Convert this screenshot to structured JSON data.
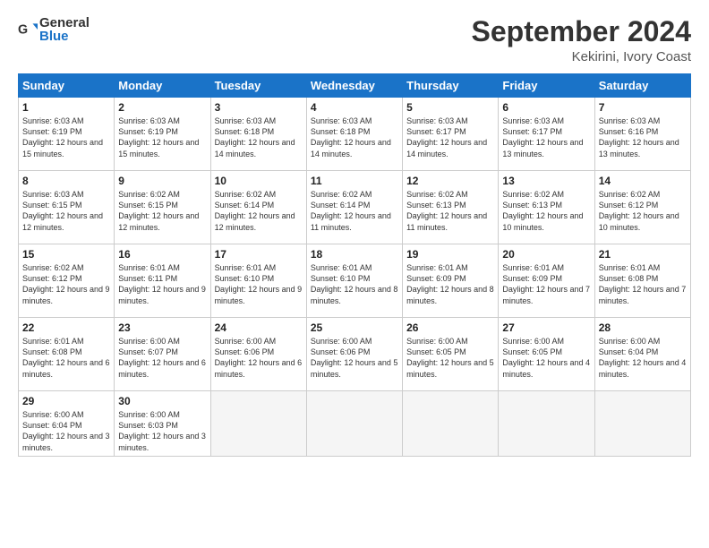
{
  "header": {
    "logo_general": "General",
    "logo_blue": "Blue",
    "month_title": "September 2024",
    "location": "Kekirini, Ivory Coast"
  },
  "weekdays": [
    "Sunday",
    "Monday",
    "Tuesday",
    "Wednesday",
    "Thursday",
    "Friday",
    "Saturday"
  ],
  "weeks": [
    [
      {
        "day": "1",
        "sunrise": "6:03 AM",
        "sunset": "6:19 PM",
        "daylight": "12 hours and 15 minutes."
      },
      {
        "day": "2",
        "sunrise": "6:03 AM",
        "sunset": "6:19 PM",
        "daylight": "12 hours and 15 minutes."
      },
      {
        "day": "3",
        "sunrise": "6:03 AM",
        "sunset": "6:18 PM",
        "daylight": "12 hours and 14 minutes."
      },
      {
        "day": "4",
        "sunrise": "6:03 AM",
        "sunset": "6:18 PM",
        "daylight": "12 hours and 14 minutes."
      },
      {
        "day": "5",
        "sunrise": "6:03 AM",
        "sunset": "6:17 PM",
        "daylight": "12 hours and 14 minutes."
      },
      {
        "day": "6",
        "sunrise": "6:03 AM",
        "sunset": "6:17 PM",
        "daylight": "12 hours and 13 minutes."
      },
      {
        "day": "7",
        "sunrise": "6:03 AM",
        "sunset": "6:16 PM",
        "daylight": "12 hours and 13 minutes."
      }
    ],
    [
      {
        "day": "8",
        "sunrise": "6:03 AM",
        "sunset": "6:15 PM",
        "daylight": "12 hours and 12 minutes."
      },
      {
        "day": "9",
        "sunrise": "6:02 AM",
        "sunset": "6:15 PM",
        "daylight": "12 hours and 12 minutes."
      },
      {
        "day": "10",
        "sunrise": "6:02 AM",
        "sunset": "6:14 PM",
        "daylight": "12 hours and 12 minutes."
      },
      {
        "day": "11",
        "sunrise": "6:02 AM",
        "sunset": "6:14 PM",
        "daylight": "12 hours and 11 minutes."
      },
      {
        "day": "12",
        "sunrise": "6:02 AM",
        "sunset": "6:13 PM",
        "daylight": "12 hours and 11 minutes."
      },
      {
        "day": "13",
        "sunrise": "6:02 AM",
        "sunset": "6:13 PM",
        "daylight": "12 hours and 10 minutes."
      },
      {
        "day": "14",
        "sunrise": "6:02 AM",
        "sunset": "6:12 PM",
        "daylight": "12 hours and 10 minutes."
      }
    ],
    [
      {
        "day": "15",
        "sunrise": "6:02 AM",
        "sunset": "6:12 PM",
        "daylight": "12 hours and 9 minutes."
      },
      {
        "day": "16",
        "sunrise": "6:01 AM",
        "sunset": "6:11 PM",
        "daylight": "12 hours and 9 minutes."
      },
      {
        "day": "17",
        "sunrise": "6:01 AM",
        "sunset": "6:10 PM",
        "daylight": "12 hours and 9 minutes."
      },
      {
        "day": "18",
        "sunrise": "6:01 AM",
        "sunset": "6:10 PM",
        "daylight": "12 hours and 8 minutes."
      },
      {
        "day": "19",
        "sunrise": "6:01 AM",
        "sunset": "6:09 PM",
        "daylight": "12 hours and 8 minutes."
      },
      {
        "day": "20",
        "sunrise": "6:01 AM",
        "sunset": "6:09 PM",
        "daylight": "12 hours and 7 minutes."
      },
      {
        "day": "21",
        "sunrise": "6:01 AM",
        "sunset": "6:08 PM",
        "daylight": "12 hours and 7 minutes."
      }
    ],
    [
      {
        "day": "22",
        "sunrise": "6:01 AM",
        "sunset": "6:08 PM",
        "daylight": "12 hours and 6 minutes."
      },
      {
        "day": "23",
        "sunrise": "6:00 AM",
        "sunset": "6:07 PM",
        "daylight": "12 hours and 6 minutes."
      },
      {
        "day": "24",
        "sunrise": "6:00 AM",
        "sunset": "6:06 PM",
        "daylight": "12 hours and 6 minutes."
      },
      {
        "day": "25",
        "sunrise": "6:00 AM",
        "sunset": "6:06 PM",
        "daylight": "12 hours and 5 minutes."
      },
      {
        "day": "26",
        "sunrise": "6:00 AM",
        "sunset": "6:05 PM",
        "daylight": "12 hours and 5 minutes."
      },
      {
        "day": "27",
        "sunrise": "6:00 AM",
        "sunset": "6:05 PM",
        "daylight": "12 hours and 4 minutes."
      },
      {
        "day": "28",
        "sunrise": "6:00 AM",
        "sunset": "6:04 PM",
        "daylight": "12 hours and 4 minutes."
      }
    ],
    [
      {
        "day": "29",
        "sunrise": "6:00 AM",
        "sunset": "6:04 PM",
        "daylight": "12 hours and 3 minutes."
      },
      {
        "day": "30",
        "sunrise": "6:00 AM",
        "sunset": "6:03 PM",
        "daylight": "12 hours and 3 minutes."
      },
      null,
      null,
      null,
      null,
      null
    ]
  ]
}
